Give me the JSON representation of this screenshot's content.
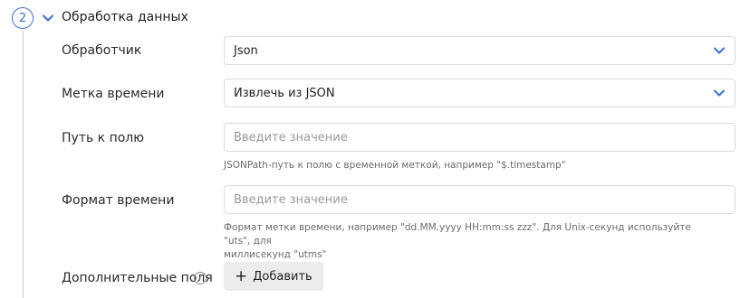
{
  "step": {
    "number": "2"
  },
  "section": {
    "title": "Обработка данных"
  },
  "fields": {
    "handler": {
      "label": "Обработчик",
      "value": "Json"
    },
    "timestamp": {
      "label": "Метка времени",
      "value": "Извлечь из JSON"
    },
    "field_path": {
      "label": "Путь к полю",
      "placeholder": "Введите значение",
      "hint": "JSONPath-путь к полю с временной меткой, например \"$.timestamp\""
    },
    "time_format": {
      "label": "Формат времени",
      "placeholder": "Введите значение",
      "hint_line1": "Формат метки времени, например \"dd.MM.yyyy HH:mm:ss zzz\". Для Unix-секунд используйте \"uts\", для",
      "hint_line2": "миллисекунд \"utms\""
    },
    "extra_fields": {
      "label": "Дополнительные поля",
      "help": "?",
      "add_label": "Добавить",
      "add_icon": "+"
    }
  },
  "colors": {
    "accent": "#3a6fd8",
    "line": "#b8cdf0",
    "button_bg": "#ececec"
  },
  "icons": {
    "toggle": "chevron-down-icon",
    "select": "chevron-down-icon",
    "help": "question-circle-icon",
    "add": "plus-icon"
  }
}
